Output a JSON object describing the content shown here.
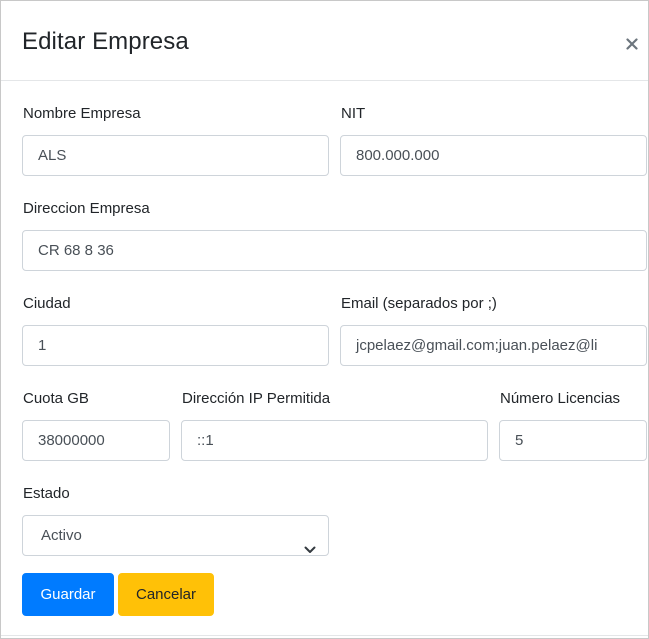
{
  "modal": {
    "title": "Editar Empresa",
    "close_symbol": "×"
  },
  "form": {
    "nombre_empresa": {
      "label": "Nombre Empresa",
      "value": "ALS"
    },
    "nit": {
      "label": "NIT",
      "value": "800.000.000"
    },
    "direccion_empresa": {
      "label": "Direccion Empresa",
      "value": "CR 68 8 36"
    },
    "ciudad": {
      "label": "Ciudad",
      "value": "1"
    },
    "email": {
      "label": "Email (separados por ;)",
      "value": "jcpelaez@gmail.com;juan.pelaez@li"
    },
    "cuota_gb": {
      "label": "Cuota GB",
      "value": "38000000"
    },
    "ip_permitida": {
      "label": "Dirección IP Permitida",
      "value": "::1"
    },
    "numero_licencias": {
      "label": "Número Licencias",
      "value": "5"
    },
    "estado": {
      "label": "Estado",
      "selected": "Activo"
    }
  },
  "actions": {
    "save_label": "Guardar",
    "cancel_label": "Cancelar"
  },
  "colors": {
    "primary": "#007bff",
    "warning": "#ffc107",
    "border": "#ced4da",
    "text": "#212529"
  },
  "icons": {
    "close": "close-icon",
    "dropdown": "chevron-down-icon"
  }
}
